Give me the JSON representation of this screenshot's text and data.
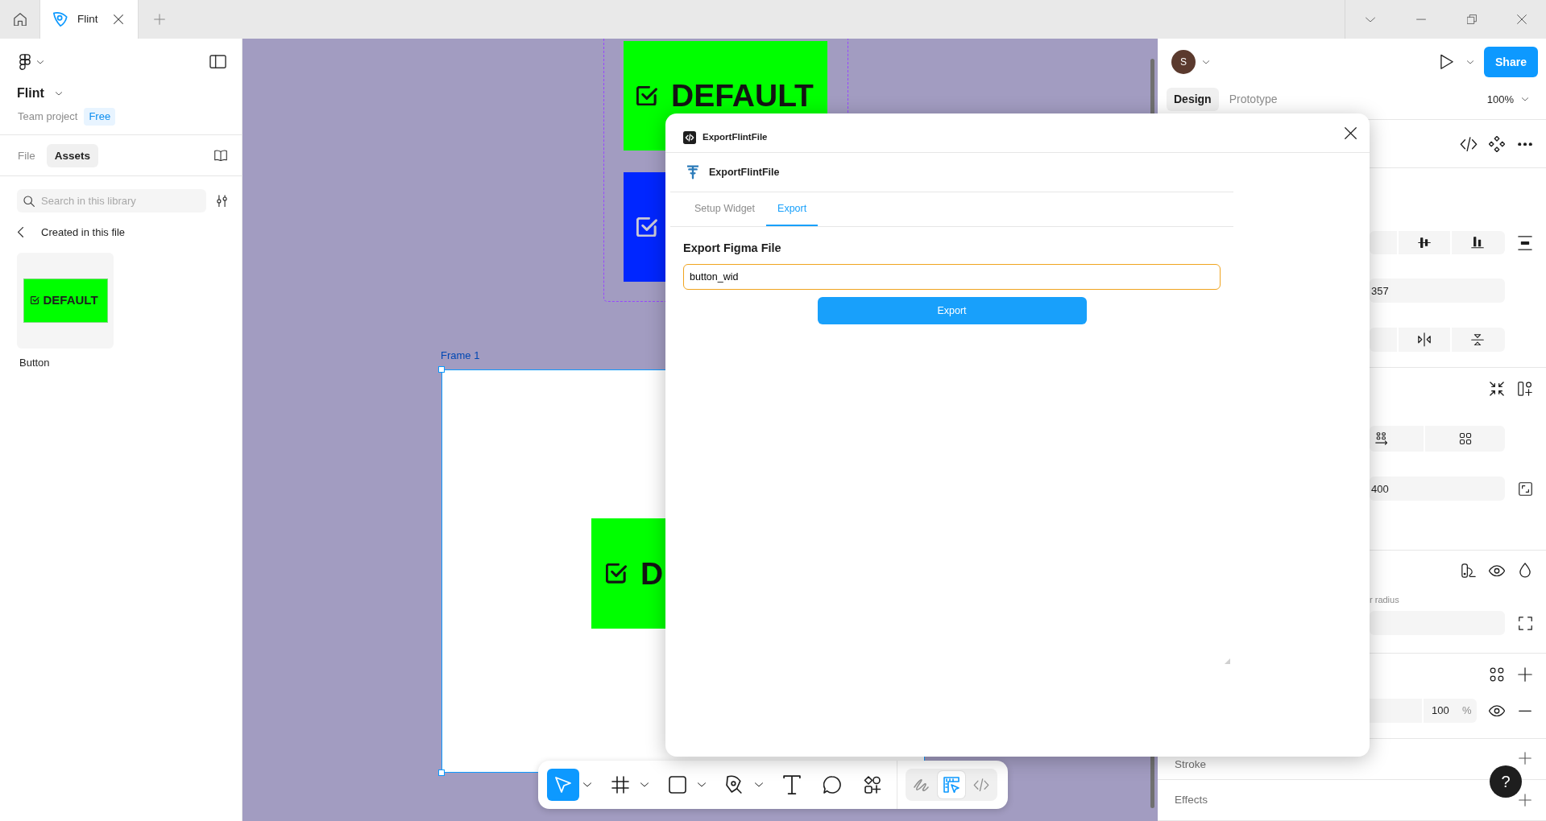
{
  "browser": {
    "tabs": [
      {
        "label": "Flint",
        "selected": true
      }
    ]
  },
  "left_panel": {
    "project": {
      "name": "Flint",
      "team": "Team project",
      "plan": "Free"
    },
    "tabs": [
      {
        "label": "File",
        "selected": false
      },
      {
        "label": "Assets",
        "selected": true
      }
    ],
    "search": {
      "placeholder": "Search in this library"
    },
    "breadcrumb": "Created in this file",
    "assets": [
      {
        "preview_label": "DEFAULT",
        "name": "Button"
      }
    ]
  },
  "canvas": {
    "component_set": {
      "variants": [
        {
          "color": "#00ff00",
          "label": "DEFAULT"
        },
        {
          "color": "#0026ff"
        }
      ]
    },
    "frame": {
      "label": "Frame 1",
      "selected": true,
      "instance": {
        "label": "D"
      }
    }
  },
  "plugin_dialog": {
    "title": "ExportFlintFile",
    "plugin_name": "ExportFlintFile",
    "tabs": [
      {
        "label": "Setup Widget",
        "selected": false
      },
      {
        "label": "Export",
        "selected": true
      }
    ],
    "heading": "Export Figma File",
    "filename_field": {
      "value": "button_wid",
      "focused": true
    },
    "export_button": "Export"
  },
  "toolbar": {
    "tools": [
      {
        "kind": "move",
        "selected": true,
        "menu": true
      },
      {
        "kind": "frame",
        "selected": false,
        "menu": true
      },
      {
        "kind": "rectangle",
        "selected": false,
        "menu": true
      },
      {
        "kind": "pen",
        "selected": false,
        "menu": true
      },
      {
        "kind": "text",
        "selected": false,
        "menu": false
      },
      {
        "kind": "comment",
        "selected": false,
        "menu": false
      },
      {
        "kind": "actions",
        "selected": false,
        "menu": false
      }
    ],
    "modes": [
      {
        "kind": "draw",
        "selected": false
      },
      {
        "kind": "design",
        "selected": true
      },
      {
        "kind": "dev",
        "selected": false
      }
    ]
  },
  "right_panel": {
    "avatar": "S",
    "share_button": "Share",
    "tabs": [
      {
        "label": "Design",
        "selected": true
      },
      {
        "label": "Prototype",
        "selected": false
      }
    ],
    "zoom": "100%",
    "field_1": "357",
    "field_2": "400",
    "label_1": "r radius",
    "opacity": {
      "value": "100",
      "unit": "%"
    },
    "sections": [
      {
        "title": "Stroke"
      },
      {
        "title": "Effects"
      }
    ],
    "help_button": "?"
  }
}
